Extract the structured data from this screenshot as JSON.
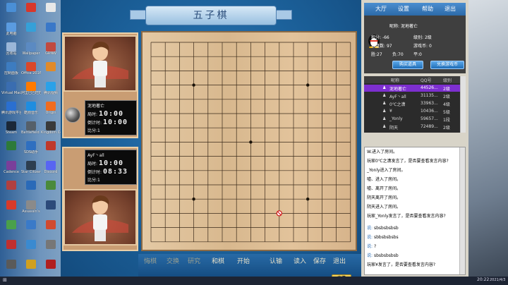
{
  "desktop": {
    "icons": [
      {
        "label": "",
        "color": "#4a8fd6"
      },
      {
        "label": "",
        "color": "#d8372b"
      },
      {
        "label": "",
        "color": "#e8e8e8"
      },
      {
        "label": "此电脑",
        "color": "#5a9be0"
      },
      {
        "label": "",
        "color": "#35a0d8"
      },
      {
        "label": "",
        "color": "#3a78c8"
      },
      {
        "label": "回收站",
        "color": "#9ab6d8"
      },
      {
        "label": "Wallpaper",
        "color": "#5b8ac2"
      },
      {
        "label": "GRNW",
        "color": "#c04a40"
      },
      {
        "label": "控制面板",
        "color": "#3d7cc0"
      },
      {
        "label": "Office 2016",
        "color": "#d9482b"
      },
      {
        "label": "",
        "color": "#e08a2a"
      },
      {
        "label": "Virtual Machine",
        "color": "#3a6db0"
      },
      {
        "label": "阿里巴巴旺旺",
        "color": "#ff7a00"
      },
      {
        "label": "腾讯视频",
        "color": "#2aa1e8"
      },
      {
        "label": "腾讯游戏平台",
        "color": "#2a6fd0"
      },
      {
        "label": "酷狗音乐",
        "color": "#1f8de0"
      },
      {
        "label": "Origin",
        "color": "#f06c20"
      },
      {
        "label": "Steam",
        "color": "#1b2838"
      },
      {
        "label": "Battlefield 1",
        "color": "#55606a"
      },
      {
        "label": "Kingdom Come",
        "color": "#3a3a3a"
      },
      {
        "label": "",
        "color": "#2d7a3a"
      },
      {
        "label": "SDS助手",
        "color": "#2f6fc0"
      },
      {
        "label": "",
        "color": "#c0392b"
      },
      {
        "label": "Cadence",
        "color": "#7a3f9a"
      },
      {
        "label": "Star Citizen",
        "color": "#2d3e50"
      },
      {
        "label": "Discord",
        "color": "#5865f2"
      },
      {
        "label": "",
        "color": "#b04040"
      },
      {
        "label": "",
        "color": "#2a6ab8"
      },
      {
        "label": "",
        "color": "#4a8a3a"
      },
      {
        "label": "",
        "color": "#d83a2a"
      },
      {
        "label": "Assassin's",
        "color": "#8a8a8a"
      },
      {
        "label": "",
        "color": "#2c4a7a"
      },
      {
        "label": "",
        "color": "#4aa04a"
      },
      {
        "label": "",
        "color": "#3a7ac8"
      },
      {
        "label": "",
        "color": "#d04a30"
      },
      {
        "label": "",
        "color": "#c03030"
      },
      {
        "label": "",
        "color": "#3a8ad0"
      },
      {
        "label": "",
        "color": "#777"
      },
      {
        "label": "",
        "color": "#5a5a5a"
      },
      {
        "label": "",
        "color": "#d0a020"
      },
      {
        "label": "",
        "color": "#b02020"
      }
    ]
  },
  "game": {
    "title": "五子棋",
    "board": {
      "lines": 15,
      "star_points": [
        [
          3,
          3
        ],
        [
          11,
          3
        ],
        [
          7,
          7
        ],
        [
          3,
          11
        ],
        [
          11,
          11
        ]
      ],
      "last_move_marker": [
        9,
        12
      ]
    },
    "player_top": {
      "name": "泥地著亡",
      "bureau_label": "局时:",
      "bureau_time": "10:00",
      "countdown_label": "倒计时:",
      "countdown_time": "10:00",
      "score_label": "比分:",
      "score": "1"
    },
    "player_bottom": {
      "name": "AyF丶all",
      "bureau_label": "局时:",
      "bureau_time": "10:00",
      "countdown_label": "倒计时:",
      "countdown_time": "08:33",
      "score_label": "比分:",
      "score": "1"
    },
    "bottom_buttons": [
      "悔棋",
      "交换",
      "研究",
      "和棋",
      "开始",
      "认输",
      "读入",
      "保存",
      "退出"
    ],
    "state_button": "表情"
  },
  "lobby": {
    "menu": [
      "大厅",
      "设置",
      "帮助",
      "退出"
    ],
    "user": {
      "nickname_label": "昵称:",
      "nickname": "泥地著亡",
      "score_label": "积分:",
      "score": "-66",
      "level_label": "级别:",
      "level": "2级",
      "total_label": "总盘数:",
      "total": "97",
      "coins_label": "游戏币:",
      "coins": "0",
      "win_label": "胜:",
      "win": "27",
      "lose_label": "负:",
      "lose": "70",
      "draw_label": "平:",
      "draw": "0"
    },
    "buy_button": "购买道具",
    "exchange_button": "兑换游戏币",
    "list_headers": [
      "昵称",
      "QQ号",
      "级别"
    ],
    "players": [
      {
        "name": "泥地著亡",
        "qq": "44526...",
        "level": "2级",
        "selected": true
      },
      {
        "name": "AyF丶all",
        "qq": "31135...",
        "level": "2级",
        "selected": false
      },
      {
        "name": "0℃之潇",
        "qq": "33963...",
        "level": "4级",
        "selected": false
      },
      {
        "name": "¥",
        "qq": "10436...",
        "level": "5级",
        "selected": false
      },
      {
        "name": "_Yonly",
        "qq": "59657...",
        "level": "1段",
        "selected": false
      },
      {
        "name": "阴天",
        "qq": "72489...",
        "level": "2级",
        "selected": false
      }
    ],
    "chat": [
      {
        "who": "",
        "text": "W.进入了房间。"
      },
      {
        "who": "",
        "text": "玩家0℃之潇发言了，是否要查看发言内容?"
      },
      {
        "who": "",
        "text": "_Yonly进入了房间。"
      },
      {
        "who": "",
        "text": "嘘、进入了房间。"
      },
      {
        "who": "",
        "text": "嘘、离开了房间。"
      },
      {
        "who": "",
        "text": "阴天离开了房间。"
      },
      {
        "who": "",
        "text": "阴天进入了房间。"
      },
      {
        "who": "",
        "text": "玩家_Yonly发言了，是否要查看发言内容?"
      },
      {
        "who": "说:",
        "text": "sbsbsbsbsb"
      },
      {
        "who": "说:",
        "text": "sbbsbsbsbs"
      },
      {
        "who": "说:",
        "text": "?"
      },
      {
        "who": "说:",
        "text": "sbsbsbsbsb"
      },
      {
        "who": "",
        "text": "玩家¥发言了，是否要查看发言内容?"
      }
    ]
  },
  "taskbar": {
    "time": "20:22",
    "date": "2021/4/3"
  }
}
